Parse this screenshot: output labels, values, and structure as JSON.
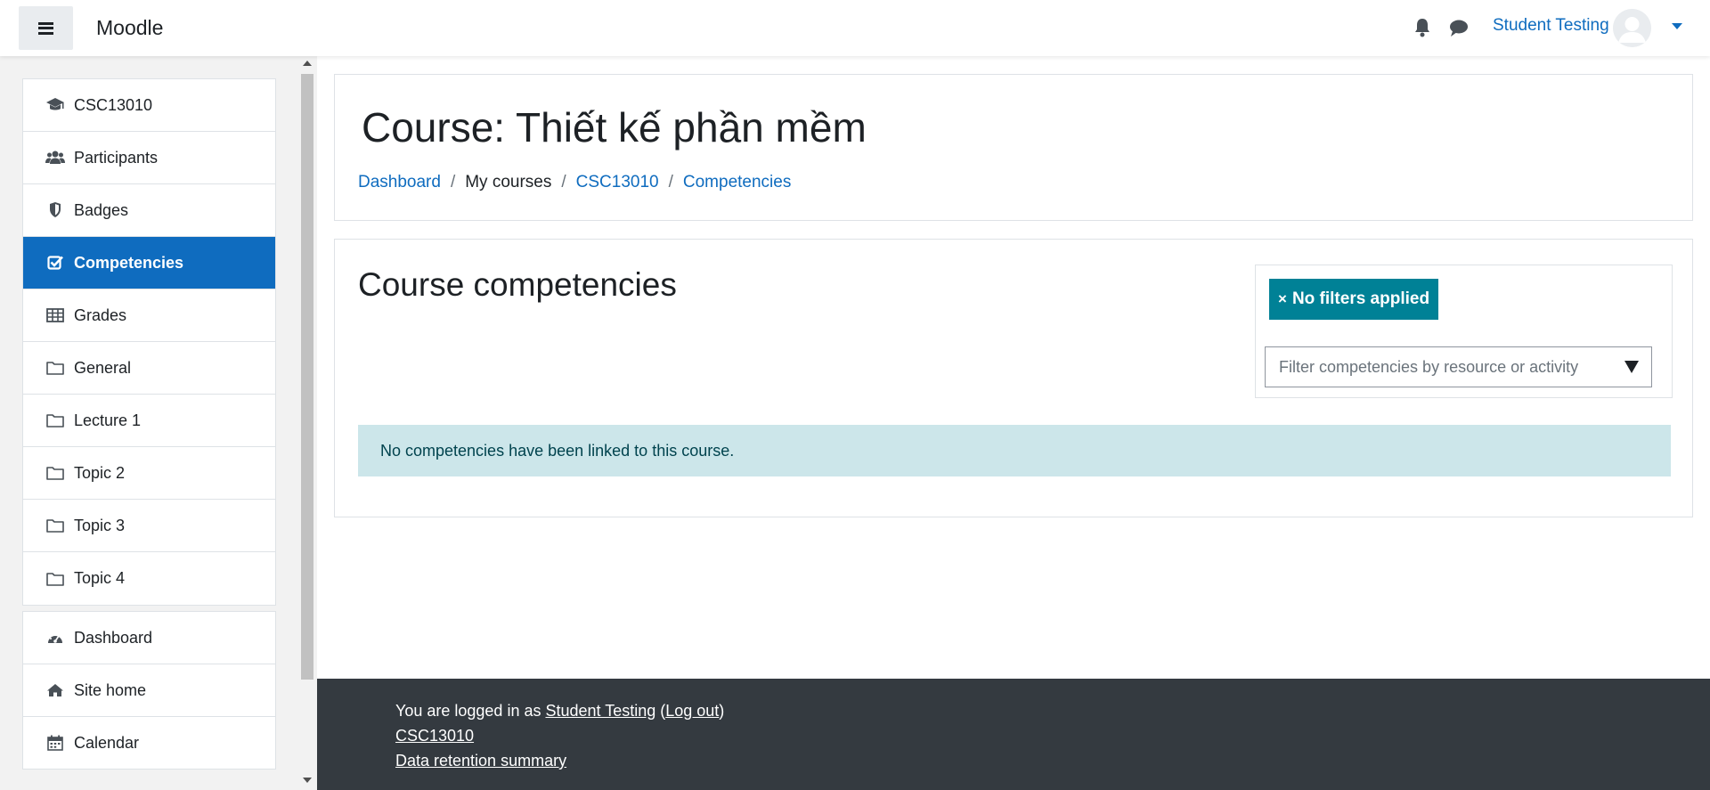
{
  "navbar": {
    "brand": "Moodle",
    "user_name": "Student Testing",
    "icons": [
      "menu-icon",
      "bell-icon",
      "chat-icon",
      "avatar-icon",
      "caret-down-icon"
    ]
  },
  "drawer": {
    "course_items": [
      {
        "label": "CSC13010",
        "icon": "graduation-cap-icon"
      },
      {
        "label": "Participants",
        "icon": "users-icon"
      },
      {
        "label": "Badges",
        "icon": "shield-icon"
      },
      {
        "label": "Competencies",
        "icon": "check-square-icon",
        "active": true
      },
      {
        "label": "Grades",
        "icon": "table-icon"
      },
      {
        "label": "General",
        "icon": "folder-icon"
      },
      {
        "label": "Lecture 1",
        "icon": "folder-icon"
      },
      {
        "label": "Topic 2",
        "icon": "folder-icon"
      },
      {
        "label": "Topic 3",
        "icon": "folder-icon"
      },
      {
        "label": "Topic 4",
        "icon": "folder-icon"
      }
    ],
    "site_items": [
      {
        "label": "Dashboard",
        "icon": "dashboard-icon"
      },
      {
        "label": "Site home",
        "icon": "home-icon"
      },
      {
        "label": "Calendar",
        "icon": "calendar-icon"
      }
    ]
  },
  "header": {
    "title": "Course: Thiết kế phần mềm",
    "breadcrumb": {
      "dashboard": "Dashboard",
      "my_courses": "My courses",
      "course": "CSC13010",
      "competencies": "Competencies",
      "separator": "/"
    }
  },
  "content": {
    "section_title": "Course competencies",
    "filter_badge": "No filters applied",
    "filter_badge_x": "×",
    "filter_placeholder": "Filter competencies by resource or activity",
    "alert": "No competencies have been linked to this course."
  },
  "footer": {
    "logged_in_prefix": "You are logged in as ",
    "user_name": "Student Testing",
    "open_paren": " (",
    "logout": "Log out",
    "close_paren": ")",
    "course_link": "CSC13010",
    "data_retention": "Data retention summary"
  },
  "colors": {
    "primary": "#0f6cbf",
    "badge": "#008196",
    "alert_bg": "#cce6ea",
    "footer_bg": "#343a40"
  }
}
